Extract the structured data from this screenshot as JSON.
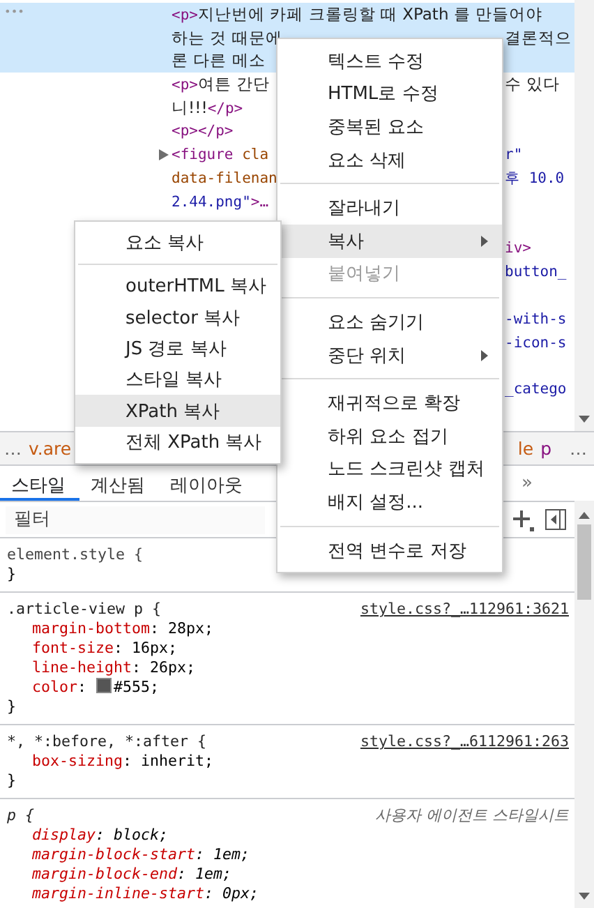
{
  "elements_panel": {
    "gutter_mark": "•••",
    "lines": [
      {
        "selected": true,
        "expandable": false,
        "left": [
          {
            "kind": "tag",
            "t": "<p>"
          },
          {
            "kind": "text",
            "t": "지난번에 카페 크롤링할 때 XPath 를 만들어야"
          }
        ]
      },
      {
        "selected": true,
        "expandable": false,
        "left": [
          {
            "kind": "text",
            "t": "하는 것 때문에"
          }
        ],
        "right": [
          {
            "kind": "text",
            "t": "결론적으"
          }
        ]
      },
      {
        "selected": true,
        "expandable": false,
        "left": [
          {
            "kind": "text",
            "t": "론 다른 메소"
          }
        ]
      },
      {
        "selected": false,
        "expandable": false,
        "left": [
          {
            "kind": "tag",
            "t": "<p>"
          },
          {
            "kind": "text",
            "t": "여튼 간단"
          }
        ],
        "right": [
          {
            "kind": "text",
            "t": "수 있다"
          }
        ]
      },
      {
        "selected": false,
        "expandable": false,
        "left": [
          {
            "kind": "text",
            "t": "니!!!"
          },
          {
            "kind": "tag",
            "t": "</p>"
          }
        ]
      },
      {
        "selected": false,
        "expandable": false,
        "left": [
          {
            "kind": "tag",
            "t": "<p></p>"
          }
        ]
      },
      {
        "selected": false,
        "expandable": true,
        "left": [
          {
            "kind": "tag",
            "t": "<figure"
          },
          {
            "kind": "attr",
            "t": " cla"
          }
        ],
        "right": [
          {
            "kind": "value",
            "t": "r\""
          }
        ]
      },
      {
        "selected": false,
        "expandable": false,
        "left": [
          {
            "kind": "attr",
            "t": "data-filenan"
          }
        ],
        "right": [
          {
            "kind": "value",
            "t": "후 10.0"
          }
        ]
      },
      {
        "selected": false,
        "expandable": false,
        "left": [
          {
            "kind": "value",
            "t": "2.44.png\""
          },
          {
            "kind": "tag",
            "t": ">…"
          }
        ]
      },
      {
        "selected": false,
        "expandable": false
      },
      {
        "selected": false,
        "expandable": false,
        "right": [
          {
            "kind": "tag",
            "t": "iv>"
          }
        ]
      },
      {
        "selected": false,
        "expandable": false,
        "right": [
          {
            "kind": "value",
            "t": "button_"
          }
        ]
      },
      {
        "selected": false,
        "expandable": false
      },
      {
        "selected": false,
        "expandable": false,
        "right": [
          {
            "kind": "value",
            "t": "-with-s"
          }
        ]
      },
      {
        "selected": false,
        "expandable": false,
        "right": [
          {
            "kind": "value",
            "t": "-icon-s"
          }
        ]
      },
      {
        "selected": false,
        "expandable": false
      },
      {
        "selected": false,
        "expandable": false,
        "right": [
          {
            "kind": "value",
            "t": "_catego"
          }
        ]
      }
    ]
  },
  "breadcrumbs": {
    "more_left": "…",
    "left_items": [
      {
        "label": "v.are",
        "kind": "class"
      }
    ],
    "right_items": [
      {
        "label": "le",
        "kind": "class"
      },
      {
        "label": "p",
        "kind": "tag"
      }
    ],
    "more_right": "…"
  },
  "tabs": [
    {
      "label": "스타일",
      "selected": true
    },
    {
      "label": "계산됨",
      "selected": false
    },
    {
      "label": "레이아웃",
      "selected": false
    }
  ],
  "tabs_overflow": "»",
  "filter": {
    "placeholder": "필터"
  },
  "style_rules": [
    {
      "selector": "element.style {",
      "kind": "inline",
      "close": "}"
    },
    {
      "selector": ".article-view p {",
      "source": "style.css?_…112961:3621",
      "kind": "link",
      "declarations": [
        {
          "name": "margin-bottom",
          "colon": ":",
          "value": "28px;"
        },
        {
          "name": "font-size",
          "colon": ":",
          "value": "16px;"
        },
        {
          "name": "line-height",
          "colon": ":",
          "value": "26px;"
        },
        {
          "name": "color",
          "colon": ":",
          "value": "#555;",
          "color": "#555555"
        }
      ],
      "close": "}"
    },
    {
      "selector": "*, *:before, *:after {",
      "source": "style.css?_…6112961:263",
      "kind": "link",
      "declarations": [
        {
          "name": "box-sizing",
          "colon": ":",
          "value": "inherit;"
        }
      ],
      "close": "}"
    },
    {
      "selector": "p {",
      "source": "사용자 에이전트 스타일시트",
      "kind": "user_agent",
      "declarations": [
        {
          "name": "display",
          "colon": ":",
          "value": "block;"
        },
        {
          "name": "margin-block-start",
          "colon": ":",
          "value": "1em;"
        },
        {
          "name": "margin-block-end",
          "colon": ":",
          "value": "1em;"
        },
        {
          "name": "margin-inline-start",
          "colon": ":",
          "value": "0px;"
        }
      ]
    }
  ],
  "context_menu": {
    "items": [
      {
        "kind": "item",
        "label": "텍스트 수정",
        "highlighted": false,
        "disabled": false,
        "submenu": false
      },
      {
        "kind": "item",
        "label": "HTML로 수정",
        "highlighted": false,
        "disabled": false,
        "submenu": false
      },
      {
        "kind": "item",
        "label": "중복된 요소",
        "highlighted": false,
        "disabled": false,
        "submenu": false
      },
      {
        "kind": "item",
        "label": "요소 삭제",
        "highlighted": false,
        "disabled": false,
        "submenu": false
      },
      {
        "kind": "separator"
      },
      {
        "kind": "item",
        "label": "잘라내기",
        "highlighted": false,
        "disabled": false,
        "submenu": false
      },
      {
        "kind": "item",
        "label": "복사",
        "highlighted": true,
        "disabled": false,
        "submenu": true
      },
      {
        "kind": "item",
        "label": "붙여넣기",
        "highlighted": false,
        "disabled": true,
        "submenu": false
      },
      {
        "kind": "separator"
      },
      {
        "kind": "item",
        "label": "요소 숨기기",
        "highlighted": false,
        "disabled": false,
        "submenu": false
      },
      {
        "kind": "item",
        "label": "중단 위치",
        "highlighted": false,
        "disabled": false,
        "submenu": true
      },
      {
        "kind": "separator"
      },
      {
        "kind": "item",
        "label": "재귀적으로 확장",
        "highlighted": false,
        "disabled": false,
        "submenu": false
      },
      {
        "kind": "item",
        "label": "하위 요소 접기",
        "highlighted": false,
        "disabled": false,
        "submenu": false
      },
      {
        "kind": "item",
        "label": "노드 스크린샷 캡처",
        "highlighted": false,
        "disabled": false,
        "submenu": false
      },
      {
        "kind": "item",
        "label": "배지 설정...",
        "highlighted": false,
        "disabled": false,
        "submenu": false
      },
      {
        "kind": "separator"
      },
      {
        "kind": "item",
        "label": "전역 변수로 저장",
        "highlighted": false,
        "disabled": false,
        "submenu": false
      }
    ]
  },
  "copy_submenu": {
    "items": [
      {
        "kind": "item",
        "label": "요소 복사",
        "highlighted": false,
        "disabled": false,
        "submenu": false
      },
      {
        "kind": "separator"
      },
      {
        "kind": "item",
        "label": "outerHTML 복사",
        "highlighted": false,
        "disabled": false,
        "submenu": false
      },
      {
        "kind": "item",
        "label": "selector 복사",
        "highlighted": false,
        "disabled": false,
        "submenu": false
      },
      {
        "kind": "item",
        "label": "JS 경로 복사",
        "highlighted": false,
        "disabled": false,
        "submenu": false
      },
      {
        "kind": "item",
        "label": "스타일 복사",
        "highlighted": false,
        "disabled": false,
        "submenu": false
      },
      {
        "kind": "item",
        "label": "XPath 복사",
        "highlighted": true,
        "disabled": false,
        "submenu": false
      },
      {
        "kind": "item",
        "label": "전체 XPath 복사",
        "highlighted": false,
        "disabled": false,
        "submenu": false
      }
    ]
  }
}
